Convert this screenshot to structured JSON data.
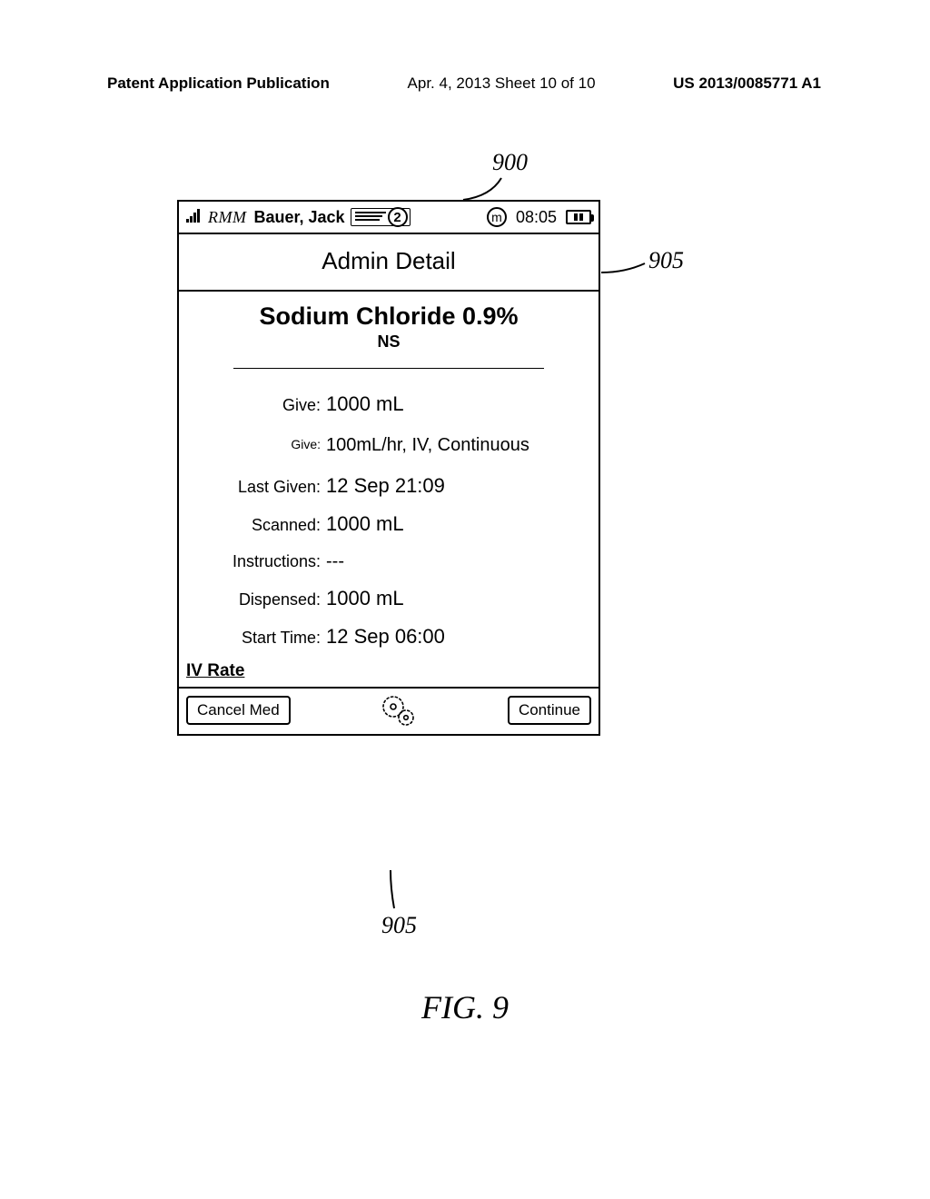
{
  "patent_header": {
    "left": "Patent Application Publication",
    "mid": "Apr. 4, 2013  Sheet 10 of 10",
    "right": "US 2013/0085771 A1"
  },
  "callouts": {
    "ref_900": "900",
    "ref_905_right": "905",
    "ref_905_bottom": "905"
  },
  "figure_label": "FIG. 9",
  "statusbar": {
    "app_abbr": "RMM",
    "patient_name": "Bauer, Jack",
    "badge_count": "2",
    "mode_letter": "m",
    "time": "08:05"
  },
  "screen": {
    "title": "Admin Detail",
    "drug_name": "Sodium Chloride 0.9%",
    "drug_abbr": "NS",
    "rows": {
      "give_amount_label": "Give:",
      "give_amount_value": "1000 mL",
      "give_rate_label": "Give:",
      "give_rate_value": "100mL/hr, IV, Continuous",
      "last_given_label": "Last Given:",
      "last_given_value": "12 Sep 21:09",
      "scanned_label": "Scanned:",
      "scanned_value": "1000 mL",
      "instructions_label": "Instructions:",
      "instructions_value": "---",
      "dispensed_label": "Dispensed:",
      "dispensed_value": "1000 mL",
      "start_time_label": "Start Time:",
      "start_time_value": "12 Sep 06:00"
    },
    "iv_rate_link": "IV Rate",
    "cancel_label": "Cancel Med",
    "continue_label": "Continue"
  }
}
